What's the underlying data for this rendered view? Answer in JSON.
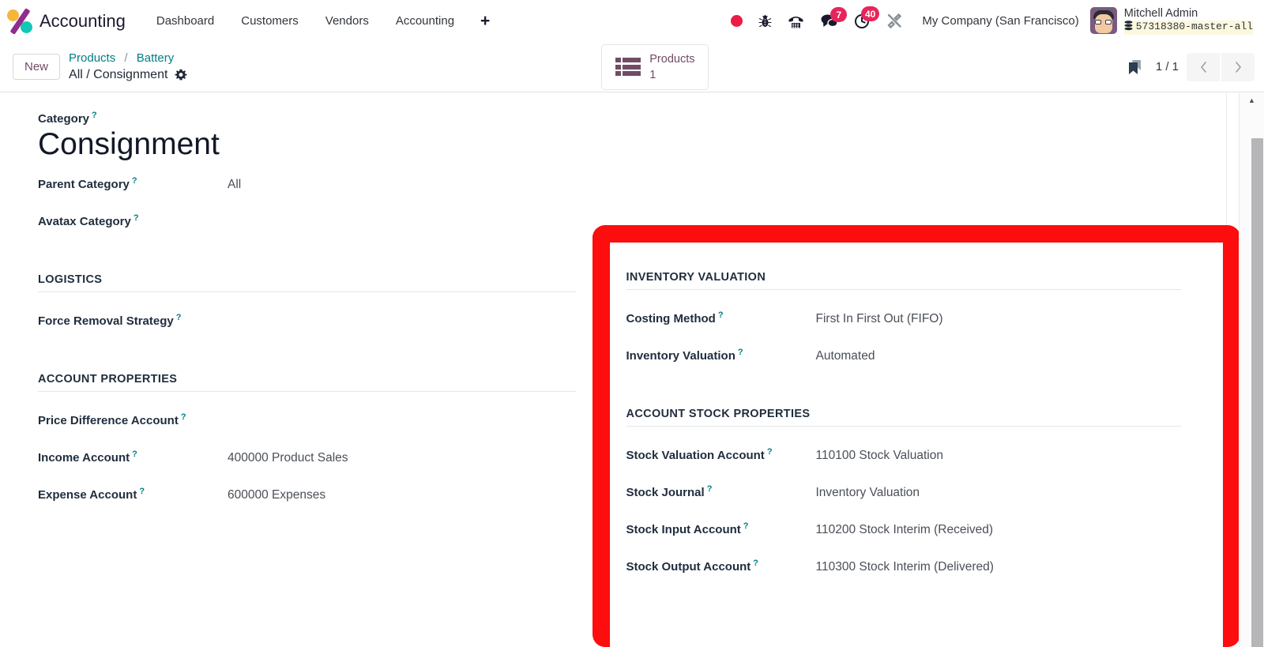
{
  "navbar": {
    "logo_icon": "accounting-app-logo",
    "brand": "Accounting",
    "menu": [
      {
        "label": "Dashboard",
        "name": "dashboard"
      },
      {
        "label": "Customers",
        "name": "customers"
      },
      {
        "label": "Vendors",
        "name": "vendors"
      },
      {
        "label": "Accounting",
        "name": "accounting"
      }
    ],
    "plus_label": "+",
    "systray": {
      "record_icon": "record-dot-icon",
      "bug_icon": "bug-icon",
      "phone_icon": "phone-icon",
      "messages_icon": "chat-bubble-icon",
      "messages_count": "7",
      "activities_icon": "clock-activity-icon",
      "activities_count": "40",
      "tools_icon": "tools-icon"
    },
    "company": "My Company (San Francisco)",
    "user": {
      "avatar_icon": "user-avatar",
      "name": "Mitchell Admin",
      "db_icon": "database-icon",
      "database": "57318380-master-all"
    }
  },
  "control_panel": {
    "new_label": "New",
    "breadcrumb": {
      "root": "Products",
      "separator": "/",
      "parent": "Battery",
      "current": "All / Consignment",
      "gear_icon": "gear-icon"
    },
    "smart_button": {
      "icon": "list-view-icon",
      "label": "Products",
      "count": "1"
    },
    "bookmark_icon": "bookmark-icon",
    "pager": {
      "value": "1 / 1",
      "prev_icon": "chevron-left-icon",
      "next_icon": "chevron-right-icon"
    }
  },
  "form": {
    "left": {
      "category_label": "Category",
      "title": "Consignment",
      "rows": [
        {
          "label": "Parent Category",
          "value": "All"
        },
        {
          "label": "Avatax Category",
          "value": ""
        }
      ],
      "logistics_section": "LOGISTICS",
      "logistics_rows": [
        {
          "label": "Force Removal Strategy",
          "value": ""
        }
      ],
      "account_section": "ACCOUNT PROPERTIES",
      "account_rows": [
        {
          "label": "Price Difference Account",
          "value": ""
        },
        {
          "label": "Income Account",
          "value": "400000 Product Sales"
        },
        {
          "label": "Expense Account",
          "value": "600000 Expenses"
        }
      ]
    },
    "right": {
      "inventory_section": "INVENTORY VALUATION",
      "inventory_rows": [
        {
          "label": "Costing Method",
          "value": "First In First Out (FIFO)"
        },
        {
          "label": "Inventory Valuation",
          "value": "Automated"
        }
      ],
      "stock_section": "ACCOUNT STOCK PROPERTIES",
      "stock_rows": [
        {
          "label": "Stock Valuation Account",
          "value": "110100 Stock Valuation"
        },
        {
          "label": "Stock Journal",
          "value": "Inventory Valuation"
        },
        {
          "label": "Stock Input Account",
          "value": "110200 Stock Interim (Received)"
        },
        {
          "label": "Stock Output Account",
          "value": "110300 Stock Interim (Delivered)"
        }
      ]
    },
    "help_marker": "?"
  },
  "highlight": {
    "color": "#fd0d0d",
    "name": "red-highlight-box"
  },
  "scrollbar": {
    "up_arrow": "▲"
  }
}
